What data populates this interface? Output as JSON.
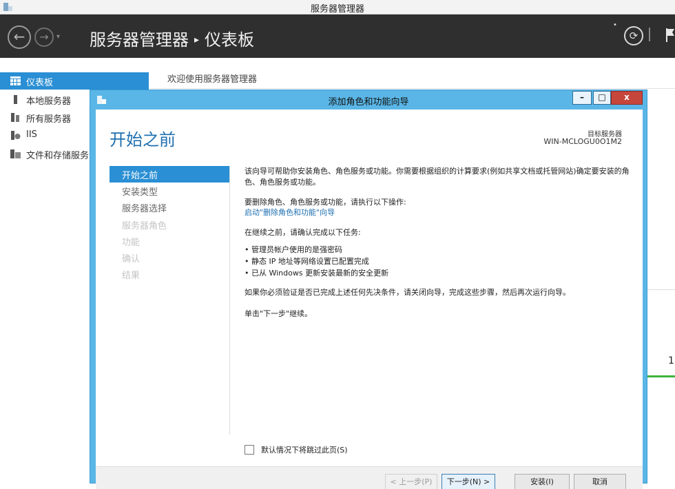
{
  "window": {
    "title": "服务器管理器"
  },
  "header": {
    "crumb_root": "服务器管理器",
    "crumb_separator": "▸",
    "crumb_current": "仪表板",
    "back_glyph": "←",
    "forward_glyph": "→",
    "refresh_glyph": "⟳"
  },
  "sidebar": {
    "items": [
      {
        "label": "仪表板",
        "icon": "dashboard-icon",
        "active": true
      },
      {
        "label": "本地服务器",
        "icon": "server-icon"
      },
      {
        "label": "所有服务器",
        "icon": "servers-icon"
      },
      {
        "label": "IIS",
        "icon": "iis-icon"
      },
      {
        "label": "文件和存储服务",
        "icon": "storage-icon"
      }
    ]
  },
  "main": {
    "welcome": "欢迎使用服务器管理器",
    "partial_number": "1"
  },
  "dialog": {
    "title": "添加角色和功能向导",
    "window_buttons": {
      "minimize": "–",
      "maximize": "□",
      "close": "x"
    },
    "heading": "开始之前",
    "target_label": "目标服务器",
    "target_value": "WIN-MCLOGU0O1M2",
    "steps": [
      {
        "label": "开始之前",
        "state": "active"
      },
      {
        "label": "安装类型",
        "state": "enabled"
      },
      {
        "label": "服务器选择",
        "state": "enabled"
      },
      {
        "label": "服务器角色",
        "state": "disabled"
      },
      {
        "label": "功能",
        "state": "disabled"
      },
      {
        "label": "确认",
        "state": "disabled"
      },
      {
        "label": "结果",
        "state": "disabled"
      }
    ],
    "content": {
      "intro": "该向导可帮助你安装角色、角色服务或功能。你需要根据组织的计算要求(例如共享文档或托管网站)确定要安装的角色、角色服务或功能。",
      "remove_intro": "要删除角色、角色服务或功能，请执行以下操作:",
      "remove_link": "启动\"删除角色和功能\"向导",
      "before_continue": "在继续之前，请确认完成以下任务:",
      "bullets": [
        "• 管理员帐户使用的是强密码",
        "• 静态 IP 地址等网络设置已配置完成",
        "• 已从 Windows 更新安装最新的安全更新"
      ],
      "verify_note": "如果你必须验证是否已完成上述任何先决条件，请关闭向导，完成这些步骤，然后再次运行向导。",
      "continue_note": "单击\"下一步\"继续。"
    },
    "skip_checkbox_label": "默认情况下将跳过此页(S)",
    "skip_checked": false,
    "buttons": {
      "prev": "< 上一步(P)",
      "next": "下一步(N) >",
      "install": "安装(I)",
      "cancel": "取消"
    }
  },
  "colors": {
    "accent": "#2a8fd4",
    "dialog_frame": "#5ab6e6",
    "header_bg": "#2f2f2f",
    "link": "#1e6fb0"
  }
}
